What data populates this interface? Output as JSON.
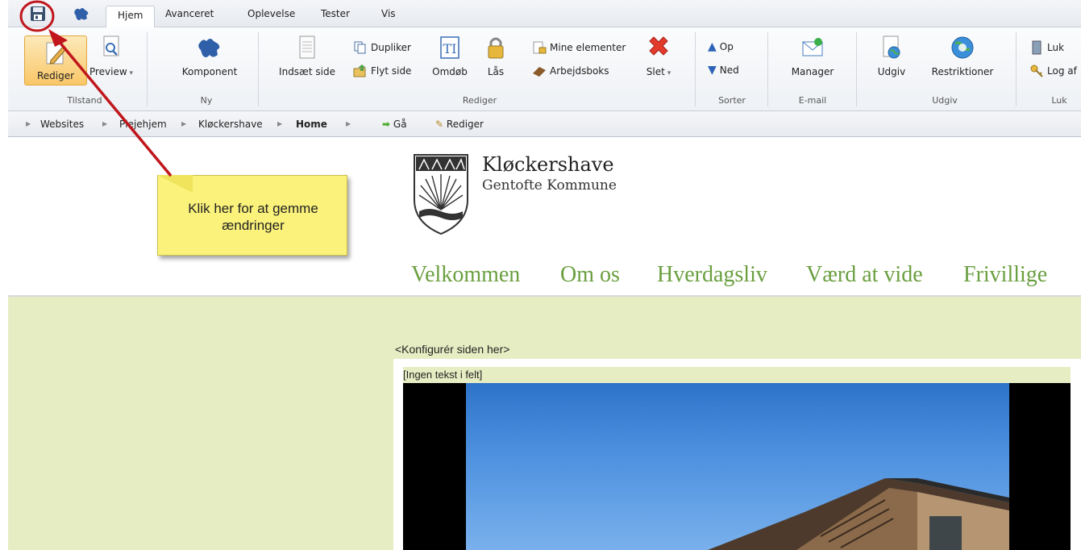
{
  "ribbon": {
    "tabs": [
      "Hjem",
      "Avanceret",
      "Oplevelse",
      "Tester",
      "Vis"
    ],
    "groups": {
      "tilstand": {
        "label": "Tilstand",
        "rediger": "Rediger",
        "preview": "Preview"
      },
      "ny": {
        "label": "Ny",
        "komponent": "Komponent"
      },
      "rediger": {
        "label": "Rediger",
        "indsaet_side": "Indsæt side",
        "dupliker": "Dupliker",
        "flyt_side": "Flyt side",
        "omdob": "Omdøb",
        "las": "Lås",
        "mine_elementer": "Mine elementer",
        "arbejdsboks": "Arbejdsboks",
        "slet": "Slet"
      },
      "sorter": {
        "label": "Sorter",
        "op": "Op",
        "ned": "Ned"
      },
      "email": {
        "label": "E-mail",
        "manager": "Manager"
      },
      "udgiv": {
        "label": "Udgiv",
        "udgiv": "Udgiv",
        "restriktioner": "Restriktioner"
      },
      "luk": {
        "label": "Luk",
        "luk": "Luk",
        "log_af": "Log af"
      }
    }
  },
  "breadcrumb": {
    "items": [
      "Websites",
      "Plejehjem",
      "Kløckershave",
      "Home"
    ],
    "ga": "Gå",
    "rediger": "Rediger"
  },
  "site": {
    "title": "Kløckershave",
    "subtitle": "Gentofte Kommune",
    "nav": [
      "Velkommen",
      "Om os",
      "Hverdagsliv",
      "Værd at vide",
      "Frivillige"
    ],
    "configure": "<Konfigurér siden her>",
    "empty_field": "[Ingen tekst i felt]"
  },
  "callout": {
    "text_line1": "Klik her for at gemme",
    "text_line2": "ændringer"
  },
  "colors": {
    "nav_green": "#6a9f3f",
    "content_bg": "#e6edc3",
    "callout": "#fbf27b",
    "annotation_red": "#c0161c"
  }
}
